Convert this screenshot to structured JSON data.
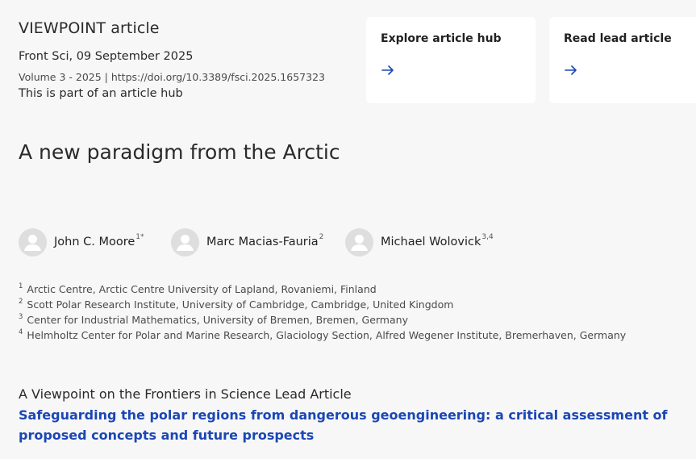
{
  "header": {
    "article_type": "VIEWPOINT article",
    "journal_date": "Front Sci, 09 September 2025",
    "volume": "Volume 3 - 2025 | ",
    "doi": "https://doi.org/10.3389/fsci.2025.1657323",
    "hub_note": "This is part of an article hub"
  },
  "cards": [
    {
      "label": "Explore article hub",
      "icon": "arrow-right-icon"
    },
    {
      "label": "Read lead article",
      "icon": "arrow-right-icon"
    }
  ],
  "title": "A new paradigm from the Arctic",
  "authors": [
    {
      "name": "John C. Moore",
      "affil": "1*"
    },
    {
      "name": "Marc Macias-Fauria",
      "affil": "2"
    },
    {
      "name": "Michael Wolovick",
      "affil": "3,4"
    }
  ],
  "affiliations": [
    {
      "num": "1",
      "text": "Arctic Centre, Arctic Centre University of Lapland, Rovaniemi, Finland"
    },
    {
      "num": "2",
      "text": "Scott Polar Research Institute, University of Cambridge, Cambridge, United Kingdom"
    },
    {
      "num": "3",
      "text": "Center for Industrial Mathematics, University of Bremen, Bremen, Germany"
    },
    {
      "num": "4",
      "text": "Helmholtz Center for Polar and Marine Research, Glaciology Section, Alfred Wegener Institute, Bremerhaven, Germany"
    }
  ],
  "lead": {
    "label": "A Viewpoint on the Frontiers in Science Lead Article",
    "link_text": "Safeguarding the polar regions from dangerous geoengineering: a critical assessment of proposed concepts and future prospects"
  },
  "colors": {
    "accent_link": "#1b47b5",
    "background": "#f7f7f7",
    "card": "#ffffff"
  }
}
